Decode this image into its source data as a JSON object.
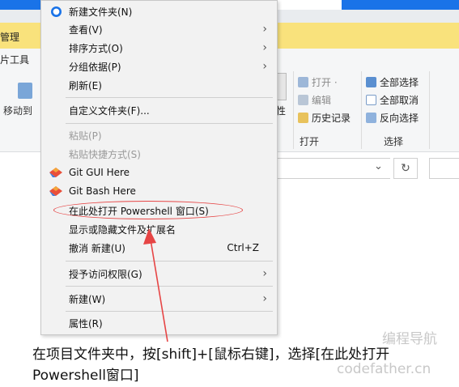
{
  "background": {
    "ribbon_top_label": "管理",
    "ribbon_tab": "片工具",
    "move_label": "移动到",
    "properties_label": "性",
    "open_group": {
      "items": [
        {
          "label": "打开 ·",
          "dim": true
        },
        {
          "label": "编辑",
          "dim": true
        },
        {
          "label": "历史记录",
          "dim": false
        }
      ],
      "footer": "打开"
    },
    "select_group": {
      "items": [
        {
          "label": "全部选择"
        },
        {
          "label": "全部取消"
        },
        {
          "label": "反向选择"
        }
      ],
      "footer": "选择"
    }
  },
  "menu": {
    "items": [
      {
        "id": "new-folder",
        "label": "新建文件夹(N)",
        "icon": "new-folder-icon",
        "disabled": false,
        "submenu": false
      },
      {
        "id": "view",
        "label": "查看(V)",
        "disabled": false,
        "submenu": true
      },
      {
        "id": "sort",
        "label": "排序方式(O)",
        "disabled": false,
        "submenu": true
      },
      {
        "id": "group",
        "label": "分组依据(P)",
        "disabled": false,
        "submenu": true
      },
      {
        "id": "refresh",
        "label": "刷新(E)",
        "disabled": false,
        "submenu": false
      },
      {
        "id": "customize",
        "label": "自定义文件夹(F)...",
        "disabled": false,
        "submenu": false
      },
      {
        "id": "paste",
        "label": "粘贴(P)",
        "disabled": true,
        "submenu": false
      },
      {
        "id": "paste-shortcut",
        "label": "粘贴快捷方式(S)",
        "disabled": true,
        "submenu": false
      },
      {
        "id": "git-gui",
        "label": "Git GUI Here",
        "icon": "git-icon",
        "disabled": false,
        "submenu": false
      },
      {
        "id": "git-bash",
        "label": "Git Bash Here",
        "icon": "git-icon",
        "disabled": false,
        "submenu": false
      },
      {
        "id": "powershell",
        "label": "在此处打开 Powershell 窗口(S)",
        "disabled": false,
        "submenu": false
      },
      {
        "id": "toggle-hidden",
        "label": "显示或隐藏文件及扩展名",
        "disabled": false,
        "submenu": false
      },
      {
        "id": "undo",
        "label": "撤消 新建(U)",
        "shortcut": "Ctrl+Z",
        "disabled": false,
        "submenu": false
      },
      {
        "id": "grant-access",
        "label": "授予访问权限(G)",
        "disabled": false,
        "submenu": true
      },
      {
        "id": "new",
        "label": "新建(W)",
        "disabled": false,
        "submenu": true
      },
      {
        "id": "properties",
        "label": "属性(R)",
        "disabled": false,
        "submenu": false
      }
    ]
  },
  "caption": "在项目文件夹中，按[shift]+[鼠标右键]，选择[在此处打开Powershell窗口]",
  "watermark": {
    "line1": "编程导航",
    "line2": "codefather.cn"
  },
  "colors": {
    "accent": "#1a73e8",
    "annotation": "#e64545",
    "highlight_band": "#f9e27c"
  }
}
